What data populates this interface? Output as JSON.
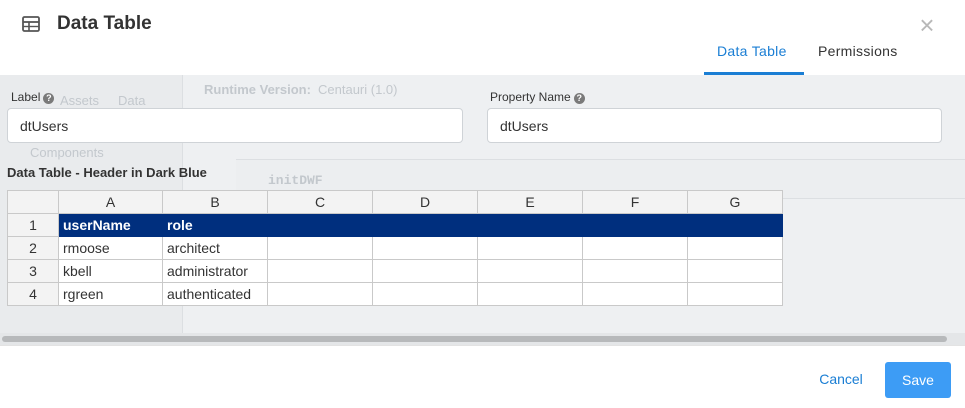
{
  "dialog": {
    "title": "Data Table",
    "icon": "table-icon",
    "close_label": "×"
  },
  "tabs": [
    {
      "label": "Data Table",
      "active": true
    },
    {
      "label": "Permissions",
      "active": false
    }
  ],
  "background": {
    "runtime_label": "Runtime Version:",
    "runtime_value": "Centauri (1.0)",
    "menu_item": "initDWF",
    "side_text_1": "Assets",
    "side_text_2": "Data",
    "side_text_3": "Components"
  },
  "form": {
    "label_field": {
      "label": "Label",
      "value": "dtUsers"
    },
    "property_field": {
      "label": "Property Name",
      "value": "dtUsers"
    }
  },
  "table_section": {
    "title": "Data Table - Header in Dark Blue",
    "columns": [
      "A",
      "B",
      "C",
      "D",
      "E",
      "F",
      "G"
    ],
    "rows": [
      {
        "num": "1",
        "cells": [
          "userName",
          "role",
          "",
          "",
          "",
          "",
          ""
        ]
      },
      {
        "num": "2",
        "cells": [
          "rmoose",
          "architect",
          "",
          "",
          "",
          "",
          ""
        ]
      },
      {
        "num": "3",
        "cells": [
          "kbell",
          "administrator",
          "",
          "",
          "",
          "",
          ""
        ]
      },
      {
        "num": "4",
        "cells": [
          "rgreen",
          "authenticated",
          "",
          "",
          "",
          "",
          ""
        ]
      }
    ],
    "header_color": "#002f7e"
  },
  "footer": {
    "cancel_label": "Cancel",
    "save_label": "Save"
  },
  "colors": {
    "accent": "#1a7ed4",
    "save_button": "#3d9cf5"
  }
}
